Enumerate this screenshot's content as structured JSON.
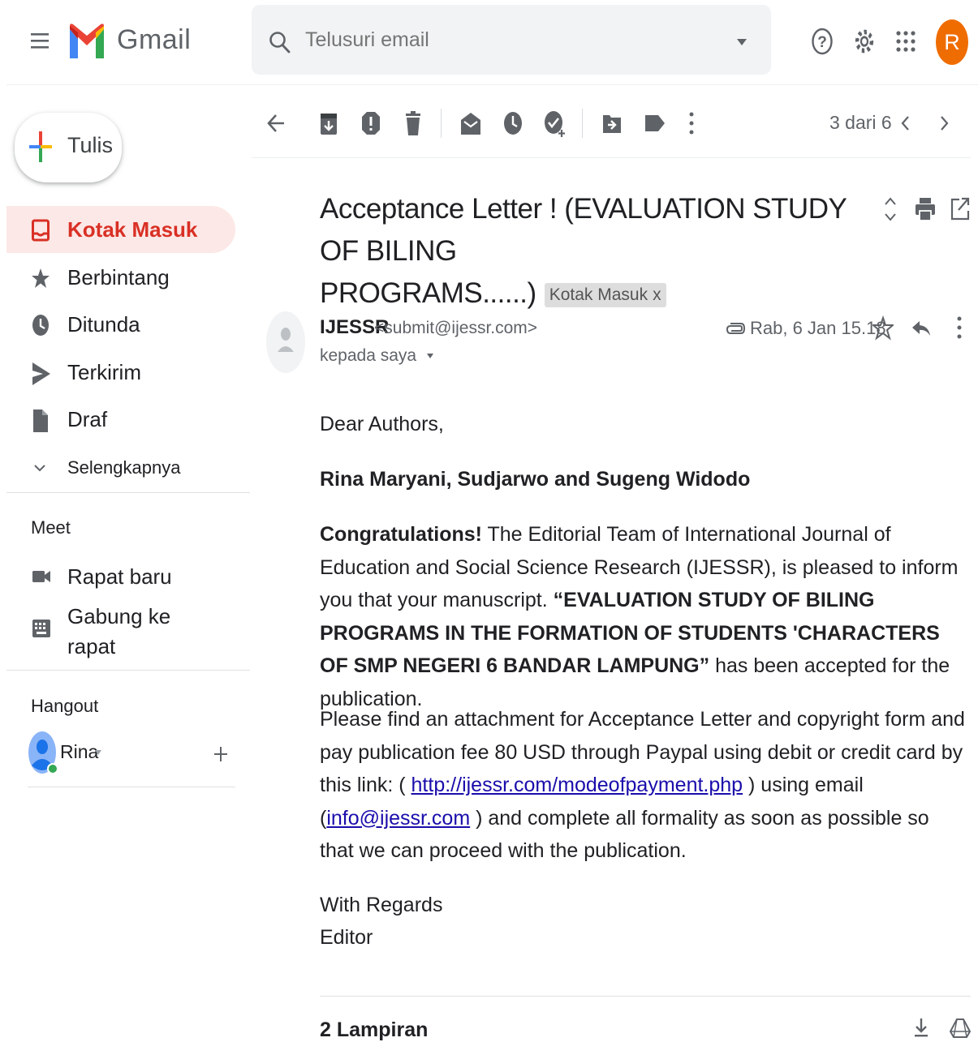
{
  "header": {
    "app_name": "Gmail",
    "search_placeholder": "Telusuri email",
    "avatar_letter": "R"
  },
  "compose": {
    "label": "Tulis"
  },
  "nav": {
    "items": [
      {
        "label": "Kotak Masuk",
        "icon": "inbox-icon"
      },
      {
        "label": "Berbintang",
        "icon": "star-icon"
      },
      {
        "label": "Ditunda",
        "icon": "clock-icon"
      },
      {
        "label": "Terkirim",
        "icon": "send-icon"
      },
      {
        "label": "Draf",
        "icon": "draft-icon"
      },
      {
        "label": "Selengkapnya",
        "icon": "chevron-down-icon"
      }
    ]
  },
  "meet": {
    "title": "Meet",
    "new_meeting": "Rapat baru",
    "join_line1": "Gabung ke",
    "join_line2": "rapat"
  },
  "hangout": {
    "title": "Hangout",
    "user": "Rina"
  },
  "toolbar": {
    "pager": "3 dari 6"
  },
  "email": {
    "subject_line1": "Acceptance Letter ! (EVALUATION STUDY OF BILING",
    "subject_line2": "PROGRAMS......)",
    "label_chip": "Kotak Masuk",
    "label_chip_close": "x",
    "sender_name": "IJESSR",
    "sender_email": "<submit@ijessr.com>",
    "to": "kepada saya",
    "date": "Rab, 6 Jan 15.18",
    "greeting": "Dear Authors,",
    "authors": "Rina Maryani, Sudjarwo and Sugeng Widodo",
    "congrats_bold": "Congratulations!",
    "congrats_text_1": " The Editorial Team of International Journal of Education and Social Science Research (IJESSR), is pleased to inform you that your manuscript.",
    "manuscript_title": "“EVALUATION STUDY OF BILING PROGRAMS IN THE FORMATION OF STUDENTS 'CHARACTERS OF SMP NEGERI 6 BANDAR LAMPUNG”",
    "congrats_text_2": " has been accepted for the publication.",
    "para2_a": "Please find an attachment for Acceptance Letter and copyright form and pay publication fee 80 USD through Paypal using debit or credit card by this link: ( ",
    "payment_link": "http://ijessr.com/modeofpayment.php",
    "para2_b": " ) using email (",
    "email_link": "info@ijessr.com",
    "para2_c": " ) and complete all formality as soon as possible so that we can proceed with the publication.",
    "regards": "With Regards",
    "signature": "Editor",
    "attachments_title": "2 Lampiran"
  }
}
